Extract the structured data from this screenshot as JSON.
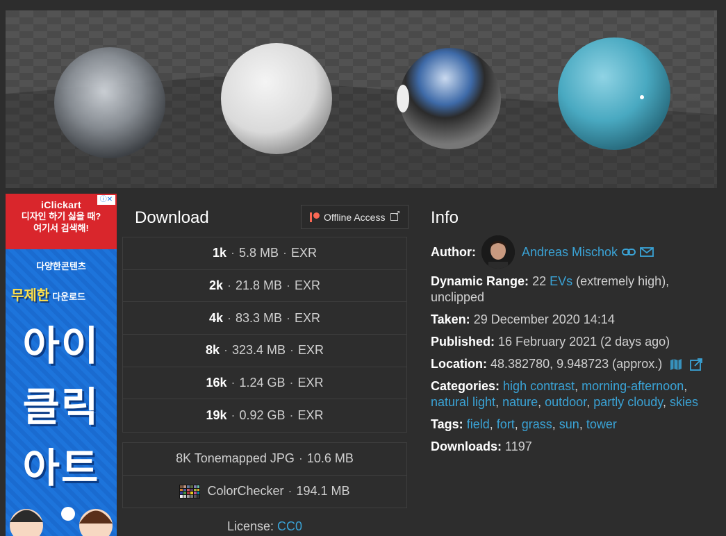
{
  "hero": {
    "alt": "HDRI preview spheres"
  },
  "ad": {
    "brand": "iClickart",
    "line1": "디자인 하기 싫을 때?",
    "line2": "여기서 검색해!",
    "close_label": "ⓘ✕",
    "tag1": "다양한콘텐츠",
    "tag2": "무제한",
    "tag2b": "다운로드",
    "big1": "아이",
    "big2": "클릭",
    "big3": "아트"
  },
  "download": {
    "title": "Download",
    "offline_label": "Offline Access",
    "files": [
      {
        "res": "1k",
        "size": "5.8 MB",
        "format": "EXR"
      },
      {
        "res": "2k",
        "size": "21.8 MB",
        "format": "EXR"
      },
      {
        "res": "4k",
        "size": "83.3 MB",
        "format": "EXR"
      },
      {
        "res": "8k",
        "size": "323.4 MB",
        "format": "EXR"
      },
      {
        "res": "16k",
        "size": "1.24 GB",
        "format": "EXR"
      },
      {
        "res": "19k",
        "size": "0.92 GB",
        "format": "EXR"
      }
    ],
    "extras": [
      {
        "name": "8K Tonemapped JPG",
        "size": "10.6 MB"
      },
      {
        "name": "ColorChecker",
        "size": "194.1 MB"
      }
    ],
    "separator": "·",
    "license_label": "License:",
    "license_value": "CC0"
  },
  "info": {
    "title": "Info",
    "author_label": "Author:",
    "author_name": "Andreas Mischok",
    "dynamic_range_label": "Dynamic Range:",
    "dynamic_range_value": "22",
    "dynamic_range_unit": "EVs",
    "dynamic_range_note": "(extremely high), unclipped",
    "taken_label": "Taken:",
    "taken_value": "29 December 2020 14:14",
    "published_label": "Published:",
    "published_value": "16 February 2021 (2 days ago)",
    "location_label": "Location:",
    "location_value": "48.382780, 9.948723 (approx.)",
    "categories_label": "Categories:",
    "categories": [
      "high contrast",
      "morning-afternoon",
      "natural light",
      "nature",
      "outdoor",
      "partly cloudy",
      "skies"
    ],
    "tags_label": "Tags:",
    "tags": [
      "field",
      "fort",
      "grass",
      "sun",
      "tower"
    ],
    "downloads_label": "Downloads:",
    "downloads_value": "1197"
  },
  "colors": {
    "link": "#3aa3d6",
    "background": "#2d2d2d",
    "patreon": "#f96854"
  }
}
